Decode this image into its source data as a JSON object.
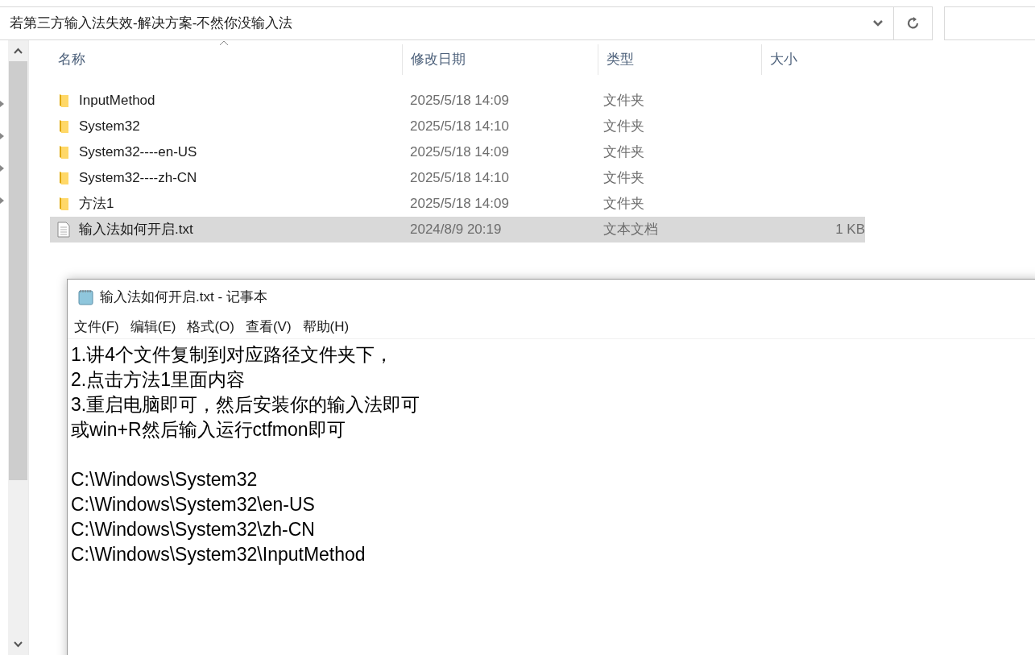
{
  "explorer": {
    "address": "若第三方输入法失效-解决方案-不然你没输入法",
    "columns": [
      "名称",
      "修改日期",
      "类型",
      "大小"
    ],
    "rows": [
      {
        "kind": "folder",
        "name": "InputMethod",
        "modified": "2025/5/18 14:09",
        "type": "文件夹",
        "selected": false
      },
      {
        "kind": "folder",
        "name": "System32",
        "modified": "2025/5/18 14:10",
        "type": "文件夹",
        "selected": false
      },
      {
        "kind": "folder",
        "name": "System32----en-US",
        "modified": "2025/5/18 14:09",
        "type": "文件夹",
        "selected": false
      },
      {
        "kind": "folder",
        "name": "System32----zh-CN",
        "modified": "2025/5/18 14:10",
        "type": "文件夹",
        "selected": false
      },
      {
        "kind": "folder",
        "name": "方法1",
        "modified": "2025/5/18 14:09",
        "type": "文件夹",
        "selected": false
      },
      {
        "kind": "file",
        "name": "输入法如何开启.txt",
        "modified": "2024/8/9 20:19",
        "type": "文本文档",
        "size": "1 KB",
        "selected": true
      }
    ]
  },
  "notepad": {
    "title": "输入法如何开启.txt - 记事本",
    "menu": [
      "文件(F)",
      "编辑(E)",
      "格式(O)",
      "查看(V)",
      "帮助(H)"
    ],
    "paragraphs": [
      [
        "1.讲4个文件复制到对应路径文件夹下，",
        "2.点击方法1里面内容",
        "3.重启电脑即可，然后安装你的输入法即可",
        "或win+R然后输入运行ctfmon即可"
      ],
      [
        "C:\\Windows\\System32",
        "C:\\Windows\\System32\\en-US",
        "C:\\Windows\\System32\\zh-CN",
        "C:\\Windows\\System32\\InputMethod"
      ]
    ]
  }
}
